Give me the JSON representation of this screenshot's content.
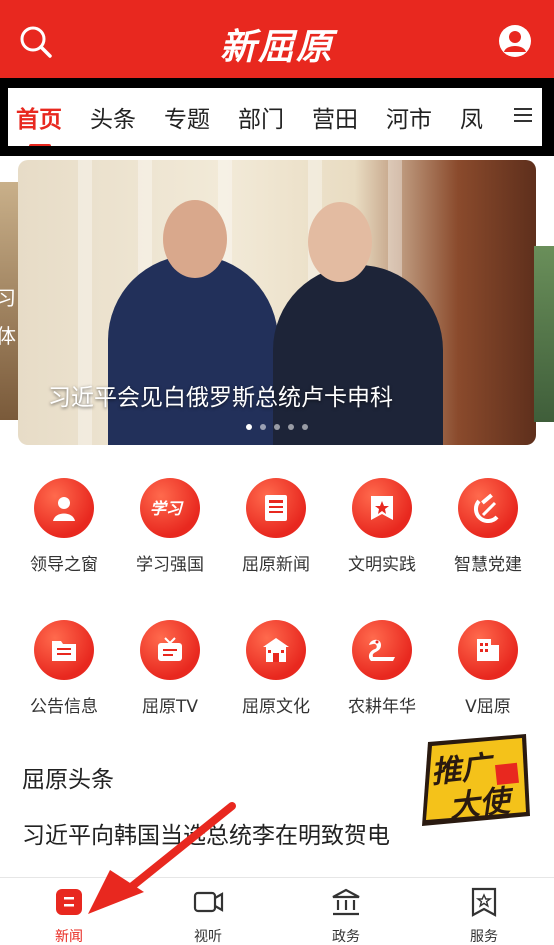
{
  "header": {
    "brand": "新屈原",
    "search_icon": "search-icon",
    "user_icon": "user-icon"
  },
  "tabs": [
    {
      "label": "首页",
      "active": true
    },
    {
      "label": "头条"
    },
    {
      "label": "专题"
    },
    {
      "label": "部门"
    },
    {
      "label": "营田"
    },
    {
      "label": "河市"
    },
    {
      "label": "凤"
    }
  ],
  "carousel": {
    "side_left_text": "习",
    "side_left_text2": "体",
    "caption": "习近平会见白俄罗斯总统卢卡申科",
    "dots_total": 5,
    "dots_active": 1
  },
  "grid": {
    "row1": [
      {
        "label": "领导之窗",
        "icon": "leader-icon"
      },
      {
        "label": "学习强国",
        "icon": "study-icon"
      },
      {
        "label": "屈原新闻",
        "icon": "news-icon"
      },
      {
        "label": "文明实践",
        "icon": "civilization-icon"
      },
      {
        "label": "智慧党建",
        "icon": "party-icon"
      }
    ],
    "row2": [
      {
        "label": "公告信息",
        "icon": "notice-icon"
      },
      {
        "label": "屈原TV",
        "icon": "tv-icon"
      },
      {
        "label": "屈原文化",
        "icon": "culture-icon"
      },
      {
        "label": "农耕年华",
        "icon": "dragon-icon"
      },
      {
        "label": "V屈原",
        "icon": "building-icon"
      }
    ]
  },
  "section": {
    "title": "屈原头条",
    "headline": "习近平向韩国当选总统李在明致贺电"
  },
  "promo": {
    "text": "推广大使",
    "icon": "promo-badge"
  },
  "bottom_nav": [
    {
      "label": "新闻",
      "icon": "news-tab-icon",
      "active": true
    },
    {
      "label": "视听",
      "icon": "video-icon"
    },
    {
      "label": "政务",
      "icon": "government-icon"
    },
    {
      "label": "服务",
      "icon": "service-icon"
    }
  ],
  "colors": {
    "brand_red": "#e8281f",
    "text": "#222222"
  }
}
